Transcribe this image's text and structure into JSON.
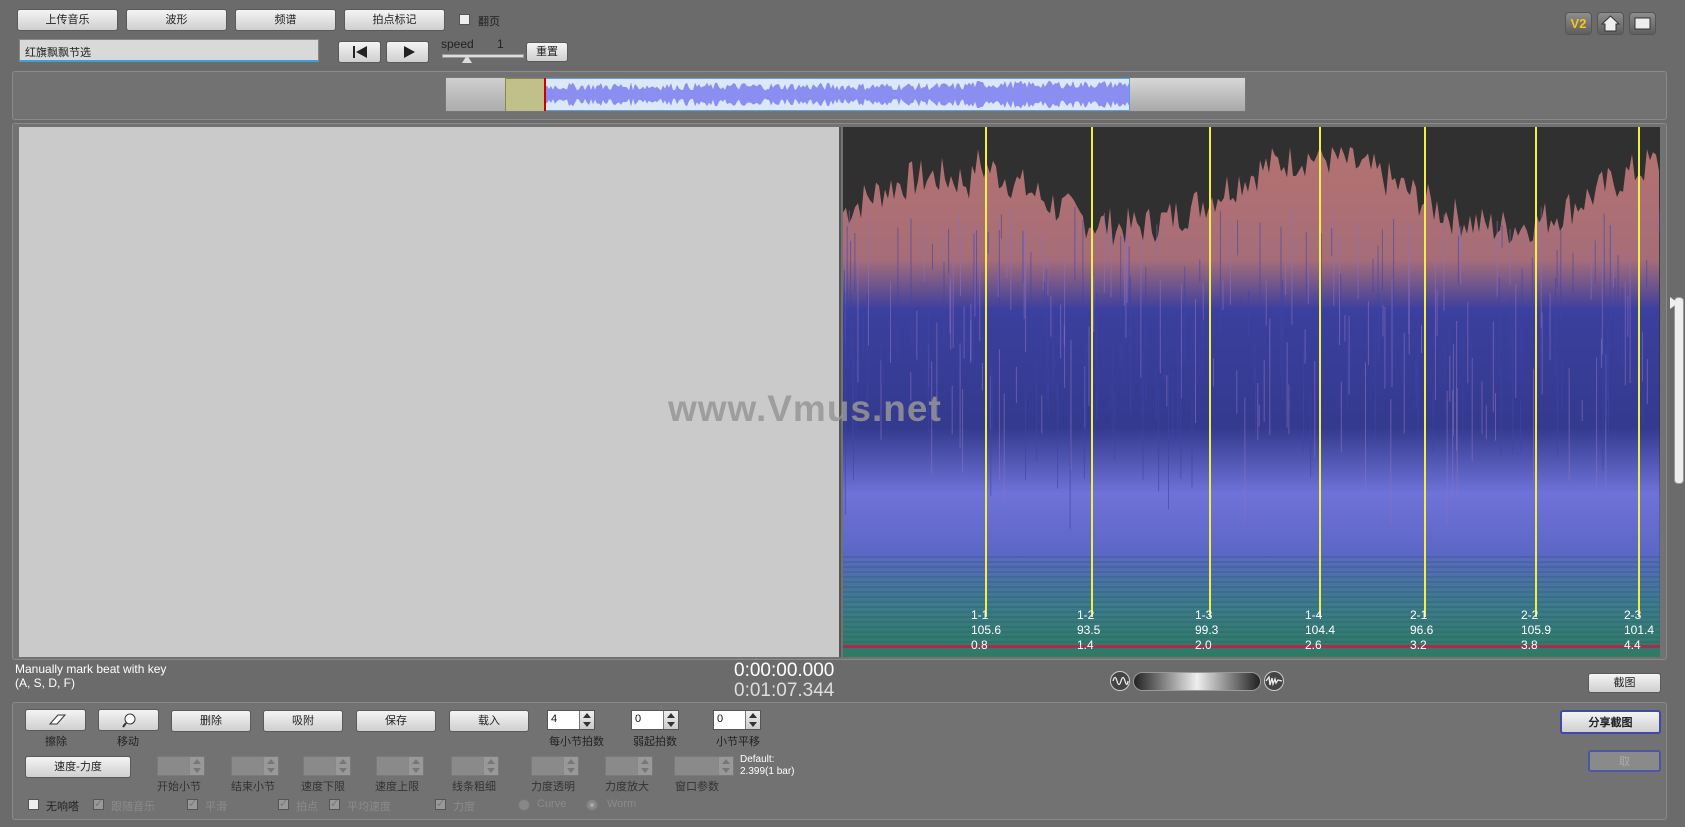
{
  "toolbar": {
    "upload_label": "上传音乐",
    "waveform_label": "波形",
    "spectrum_label": "频谱",
    "beat_mark_label": "拍点标记",
    "flip_label": "翻页",
    "song_title": "红旗飘飘节选",
    "speed_label": "speed",
    "speed_value": "1",
    "reset_label": "重置"
  },
  "overlay": {
    "watermark": "www.Vmus.net"
  },
  "status": {
    "hint_line1": "Manually mark beat with key",
    "hint_line2": "(A, S, D, F)",
    "time_current": "0:00:00.000",
    "time_total": "0:01:07.344",
    "screenshot_label": "截图",
    "share_label": "分享截图",
    "disabled_label": "取"
  },
  "beats": [
    {
      "label": "1-1",
      "tempo": "105.6",
      "time": "0.8"
    },
    {
      "label": "1-2",
      "tempo": "93.5",
      "time": "1.4"
    },
    {
      "label": "1-3",
      "tempo": "99.3",
      "time": "2.0"
    },
    {
      "label": "1-4",
      "tempo": "104.4",
      "time": "2.6"
    },
    {
      "label": "2-1",
      "tempo": "96.6",
      "time": "3.2"
    },
    {
      "label": "2-2",
      "tempo": "105.9",
      "time": "3.8"
    },
    {
      "label": "2-3",
      "tempo": "101.4",
      "time": "4.4"
    }
  ],
  "controls": {
    "erase_label": "擦除",
    "move_label": "移动",
    "delete_label": "删除",
    "snap_label": "吸附",
    "save_label": "保存",
    "load_label": "载入",
    "beats_per_bar": "4",
    "beats_per_bar_label": "每小节拍数",
    "pickup_beats": "0",
    "pickup_beats_label": "弱起拍数",
    "bar_offset": "0",
    "bar_offset_label": "小节平移",
    "tempo_dynamics_label": "速度-力度",
    "start_bar_label": "开始小节",
    "end_bar_label": "结束小节",
    "tempo_min_label": "速度下限",
    "tempo_max_label": "速度上限",
    "line_width_label": "线条粗细",
    "dyn_opacity_label": "力度透明",
    "dyn_scale_label": "力度放大",
    "window_param_label": "窗口参数",
    "default_line1": "Default:",
    "default_line2": "2.399(1 bar)",
    "no_metronome_label": "无响嗒",
    "follow_music_label": "跟随音乐",
    "smooth_label": "平滑",
    "beat_point_label": "拍点",
    "avg_tempo_label": "平均速度",
    "dynamics_label": "力度",
    "curve_label": "Curve",
    "worm_label": "Worm"
  }
}
